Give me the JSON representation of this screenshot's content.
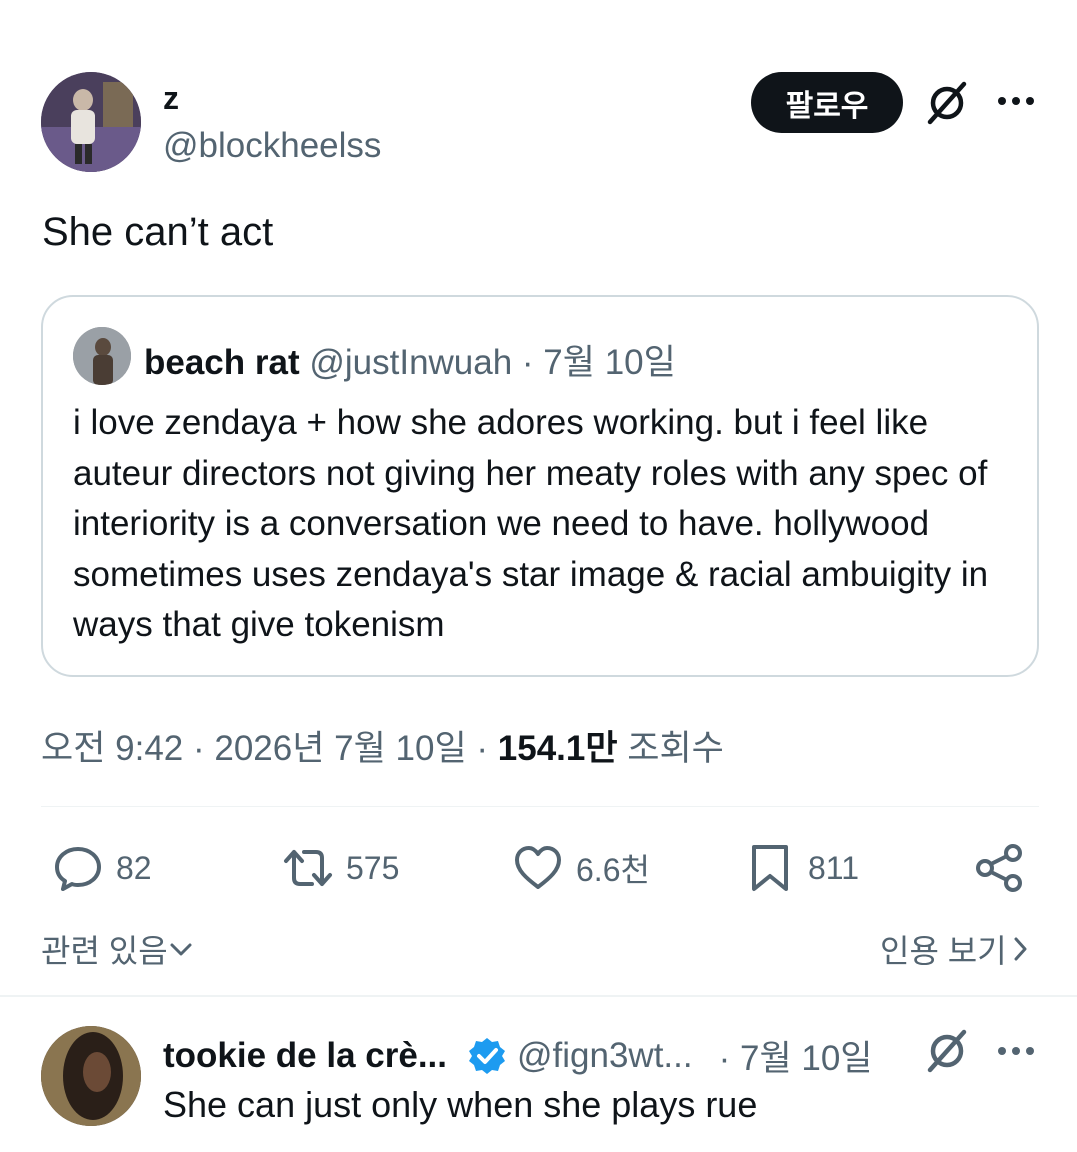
{
  "tweet": {
    "author": {
      "name": "z",
      "handle": "@blockheelss"
    },
    "follow_label": "팔로우",
    "text": "She can’t act",
    "quoted": {
      "author_name": "beach rat",
      "meta": " @justInwuah · 7월 10일",
      "text": "i love zendaya + how she adores working. but i feel like auteur directors not giving her meaty roles with any spec of interiority is a conversation we need to have. hollywood sometimes uses zendaya's star image & racial ambuigity in ways that give tokenism"
    },
    "meta": {
      "time_date": "오전 9:42 · 2026년 7월 10일 · ",
      "views": "154.1만",
      "views_label": " 조회수"
    },
    "actions": {
      "replies": "82",
      "retweets": "575",
      "likes": "6.6천",
      "bookmarks": "811"
    },
    "related_label": "관련 있음",
    "quotes_label": "인용 보기"
  },
  "reply": {
    "name": "tookie de la crè...",
    "handle": "@fign3wt...",
    "date": "· 7월 10일",
    "text": "She can just only when she plays rue"
  },
  "icons": [
    "grok-icon",
    "more-icon",
    "reply-icon",
    "retweet-icon",
    "like-icon",
    "bookmark-icon",
    "share-icon",
    "chevron-down-icon",
    "chevron-right-icon",
    "verified-badge-icon"
  ],
  "colors": {
    "text": "#0f1419",
    "secondary": "#536471",
    "border": "#cfd9de",
    "verified": "#1d9bf0"
  }
}
